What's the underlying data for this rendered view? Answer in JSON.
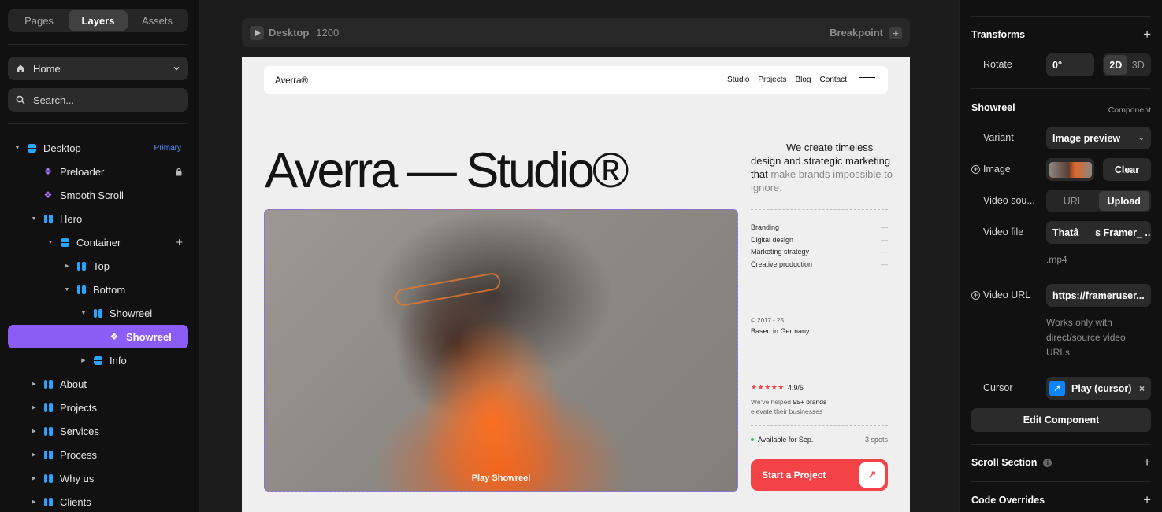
{
  "left_panel": {
    "tabs": [
      "Pages",
      "Layers",
      "Assets"
    ],
    "active_tab": "Layers",
    "page_selector": {
      "label": "Home",
      "icon": "home-icon"
    },
    "search": {
      "placeholder": "Search..."
    },
    "layers": [
      {
        "name": "Desktop",
        "badge": "Primary",
        "icon": "stack-icon",
        "depth": 0,
        "expanded": true
      },
      {
        "name": "Preloader",
        "icon": "component-icon",
        "depth": 1,
        "locked": true
      },
      {
        "name": "Smooth Scroll",
        "icon": "component-icon",
        "depth": 1
      },
      {
        "name": "Hero",
        "icon": "columns-icon",
        "depth": 1,
        "expanded": true
      },
      {
        "name": "Container",
        "icon": "stack-icon",
        "depth": 2,
        "expanded": true,
        "action": "+"
      },
      {
        "name": "Top",
        "icon": "columns-icon",
        "depth": 3,
        "expanded": false
      },
      {
        "name": "Bottom",
        "icon": "columns-icon",
        "depth": 3,
        "expanded": true
      },
      {
        "name": "Showreel",
        "icon": "columns-icon",
        "depth": 4,
        "expanded": true
      },
      {
        "name": "Showreel",
        "icon": "component-icon",
        "depth": 5,
        "selected": true
      },
      {
        "name": "Info",
        "icon": "stack-icon",
        "depth": 4,
        "expanded": false
      },
      {
        "name": "About",
        "icon": "columns-icon",
        "depth": 1,
        "expanded": false
      },
      {
        "name": "Projects",
        "icon": "columns-icon",
        "depth": 1,
        "expanded": false
      },
      {
        "name": "Services",
        "icon": "columns-icon",
        "depth": 1,
        "expanded": false
      },
      {
        "name": "Process",
        "icon": "columns-icon",
        "depth": 1,
        "expanded": false
      },
      {
        "name": "Why us",
        "icon": "columns-icon",
        "depth": 1,
        "expanded": false
      },
      {
        "name": "Clients",
        "icon": "columns-icon",
        "depth": 1,
        "expanded": false
      }
    ]
  },
  "canvas": {
    "breakpoint_bar": {
      "name": "Desktop",
      "width": "1200",
      "right_label": "Breakpoint"
    },
    "site": {
      "logo": "Averra®",
      "nav_links": [
        "Studio",
        "Projects",
        "Blog",
        "Contact"
      ],
      "hero_title": "Averra — Studio®",
      "tagline_dark": "We create timeless design and strategic marketing that",
      "tagline_gray": "make brands impossible to ignore.",
      "services": [
        "Branding",
        "Digital design",
        "Marketing strategy",
        "Creative production"
      ],
      "service_dash": "—",
      "years": "© 2017 - 25",
      "location": "Based in Germany",
      "rating": "4.9/5",
      "stars": "★★★★★",
      "helped_prefix": "We've helped ",
      "helped_bold": "95+ brands",
      "helped_suffix": "elevate their businesses",
      "availability": "Available for Sep.",
      "spots": "3 spots",
      "cta": "Start a Project",
      "cta_icon": "↗",
      "showreel_label": "Play Showreel"
    }
  },
  "right_panel": {
    "transforms": {
      "title": "Transforms",
      "rotate_label": "Rotate",
      "rotate_value": "0°",
      "modes": [
        "2D",
        "3D"
      ],
      "active_mode": "2D"
    },
    "showreel": {
      "title": "Showreel",
      "tag": "Component",
      "variant_label": "Variant",
      "variant_value": "Image preview",
      "image_label": "Image",
      "clear_label": "Clear",
      "video_source_label": "Video sou...",
      "video_source_options": [
        "URL",
        "Upload"
      ],
      "video_source_active": "Upload",
      "video_file_label": "Video file",
      "video_file_value": "Thatâ      s Framer_ ...",
      "video_file_ext": ".mp4",
      "video_url_label": "Video URL",
      "video_url_value": "https://frameruser...",
      "video_url_note": "Works only with direct/source video URLs",
      "cursor_label": "Cursor",
      "cursor_value": "Play (cursor)",
      "edit_button": "Edit Component"
    },
    "scroll_section": {
      "title": "Scroll Section"
    },
    "code_overrides": {
      "title": "Code Overrides"
    }
  }
}
